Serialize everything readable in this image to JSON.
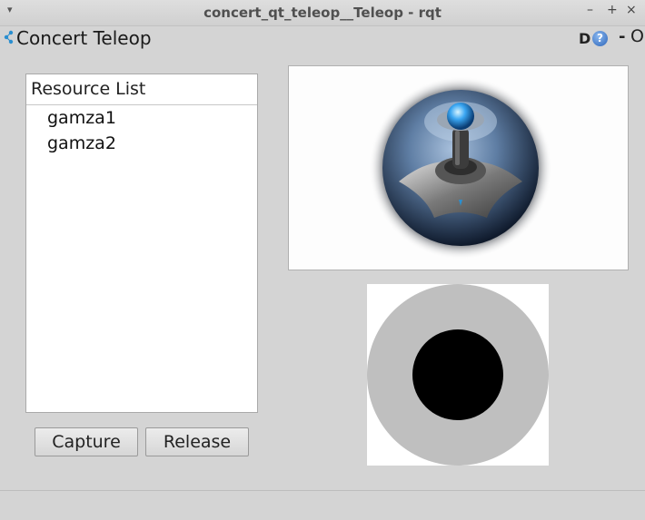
{
  "window": {
    "title": "concert_qt_teleop__Teleop - rqt",
    "menu_glyph": "▾",
    "minimize_glyph": "–",
    "maximize_glyph": "+",
    "close_glyph": "×"
  },
  "plugin": {
    "title": "Concert Teleop",
    "d_label": "D",
    "help_glyph": "?",
    "dash_label": "-",
    "o_label": "O"
  },
  "resource_list": {
    "header": "Resource List",
    "items": [
      "gamza1",
      "gamza2"
    ]
  },
  "buttons": {
    "capture": "Capture",
    "release": "Release"
  },
  "icons": {
    "plugin": "ros-plugin-icon",
    "help": "help-icon",
    "camera": "joystick-image"
  },
  "colors": {
    "pad_outer": "#bfbfbf",
    "pad_knob": "#000000"
  }
}
